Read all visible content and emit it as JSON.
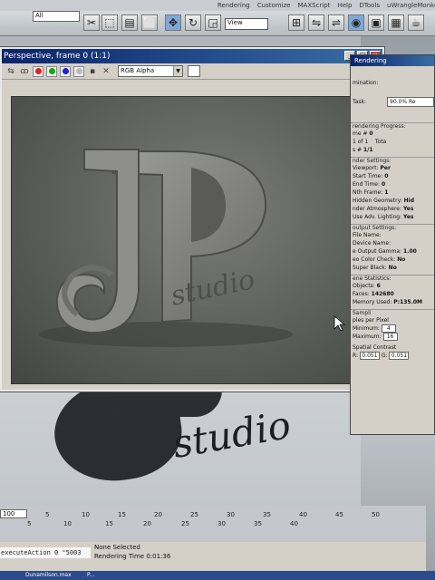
{
  "menubar": {
    "items": [
      "Rendering",
      "Customize",
      "MAXScript",
      "Help",
      "DTools",
      "uWrangleMonkey"
    ]
  },
  "toolbar": {
    "selection_filter": "All",
    "view_select": "View"
  },
  "render_window": {
    "title": "Perspective, frame 0 (1:1)",
    "channel": "RGB Alpha",
    "controls": {
      "minimize": "_",
      "restore": "□",
      "close": "×"
    }
  },
  "logo": {
    "letters": "JP",
    "word": "studio"
  },
  "progress_window": {
    "title": "Rendering",
    "subtitle": "mination:",
    "task_label": "Task:",
    "task_value": "90.0% Re",
    "group_progress": "rendering Progress:",
    "frame_label": "me #",
    "frame_value": "0",
    "of_1": "1 of 1",
    "tota": "Tota",
    "frames_label": "s #",
    "frames_value": "1/1",
    "group_settings": "nder Settings:",
    "settings": [
      {
        "label": "Viewport:",
        "value": "Per"
      },
      {
        "label": "Start Time:",
        "value": "0"
      },
      {
        "label": "End Time:",
        "value": "0"
      },
      {
        "label": "Nth Frame:",
        "value": "1"
      },
      {
        "label": "Hidden Geometry:",
        "value": "Hid"
      },
      {
        "label": "nder Atmosphere:",
        "value": "Yes"
      },
      {
        "label": "Use Adv. Lighting:",
        "value": "Yes"
      }
    ],
    "group_output": "output Settings:",
    "output": [
      {
        "label": "File Name:",
        "value": ""
      },
      {
        "label": "Device Name:",
        "value": ""
      },
      {
        "label": "e Output Gamma:",
        "value": "1.00"
      },
      {
        "label": "eo Color Check:",
        "value": "No"
      },
      {
        "label": "Super Black:",
        "value": "No"
      }
    ],
    "group_stats": "ene Statistics:",
    "stats": [
      {
        "label": "Objects:",
        "value": "6"
      },
      {
        "label": "Faces:",
        "value": "142680"
      },
      {
        "label": "Memory Used:",
        "value": "P:135.0M"
      }
    ],
    "sampling_label": "Sampli",
    "samples_label": "ples per Pixel",
    "minimum_label": "Minimum:",
    "minimum_value": "4",
    "maximum_label": "Maximum:",
    "maximum_value": "16",
    "spatial_label": "Spatial Contrast",
    "r_label": "R:",
    "r_value": "0.051",
    "g_label": "G:",
    "g_value": "0.051"
  },
  "timeline": {
    "current_frame": "100",
    "upper_ticks": [
      "5",
      "10",
      "15",
      "20",
      "25",
      "30",
      "35",
      "40",
      "45",
      "50"
    ],
    "lower_ticks": [
      "5",
      "10",
      "15",
      "20",
      "25",
      "30",
      "35",
      "40"
    ]
  },
  "status": {
    "maxscript": "executeAction 0 \"5003",
    "selection": "None Selected",
    "render_time": "Rendering Time  0:01:36"
  },
  "taskbar": {
    "items": [
      "Dunamilson.max",
      "P..."
    ]
  }
}
